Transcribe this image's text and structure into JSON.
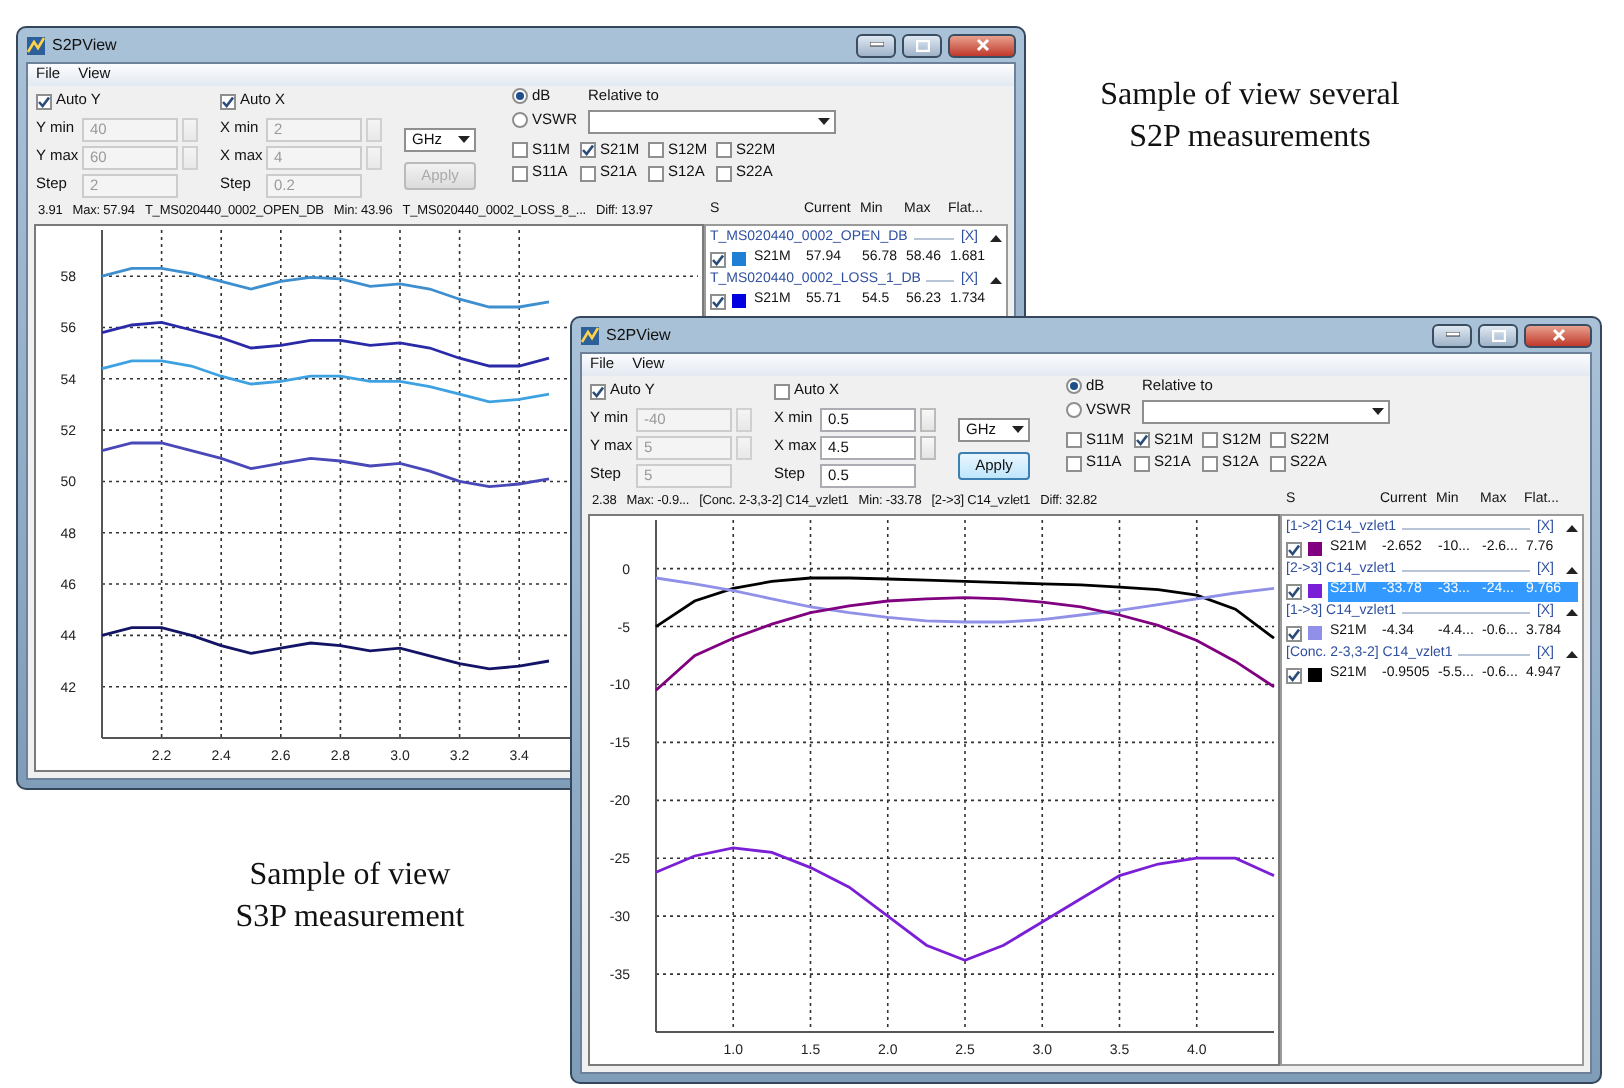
{
  "windows": [
    {
      "title": "S2PView",
      "menu": [
        {
          "label": "File"
        },
        {
          "label": "View"
        }
      ],
      "auto_y": {
        "label": "Auto Y",
        "checked": true
      },
      "y_fields": [
        {
          "label": "Y min",
          "value": "40",
          "kind": "spin",
          "disabled": true
        },
        {
          "label": "Y max",
          "value": "60",
          "kind": "spin",
          "disabled": true
        },
        {
          "label": "Step",
          "value": "2",
          "kind": "text",
          "disabled": true
        }
      ],
      "auto_x": {
        "label": "Auto X",
        "checked": true
      },
      "x_fields": [
        {
          "label": "X min",
          "value": "2",
          "kind": "spin",
          "disabled": true
        },
        {
          "label": "X max",
          "value": "4",
          "kind": "spin",
          "disabled": true
        },
        {
          "label": "Step",
          "value": "0.2",
          "kind": "text",
          "disabled": true
        }
      ],
      "unit": {
        "value": "GHz"
      },
      "apply": {
        "label": "Apply",
        "disabled": true
      },
      "scale": [
        {
          "label": "dB",
          "selected": true
        },
        {
          "label": "VSWR",
          "selected": false
        }
      ],
      "relative_to": {
        "label": "Relative to"
      },
      "params": [
        {
          "label": "S11M",
          "checked": false
        },
        {
          "label": "S21M",
          "checked": true
        },
        {
          "label": "S12M",
          "checked": false
        },
        {
          "label": "S22M",
          "checked": false
        },
        {
          "label": "S11A",
          "checked": false
        },
        {
          "label": "S21A",
          "checked": false
        },
        {
          "label": "S12A",
          "checked": false
        },
        {
          "label": "S22A",
          "checked": false
        }
      ],
      "status": [
        "3.91",
        "Max: 57.94",
        "T_MS020440_0002_OPEN_DB",
        "Min: 43.96",
        "T_MS020440_0002_LOSS_8_...",
        "Diff: 13.97"
      ],
      "list": {
        "columns": [
          "S",
          "Current",
          "Min",
          "Max",
          "Flat..."
        ],
        "groups": [
          {
            "name": "T_MS020440_0002_OPEN_DB",
            "remove": "[X]",
            "rows": [
              {
                "checked": true,
                "color": "#1e7fd4",
                "param": "S21M",
                "current": "57.94",
                "min": "56.78",
                "max": "58.46",
                "flat": "1.681",
                "selected": false
              }
            ]
          },
          {
            "name": "T_MS020440_0002_LOSS_1_DB",
            "remove": "[X]",
            "rows": [
              {
                "checked": true,
                "color": "#0000e0",
                "param": "S21M",
                "current": "55.71",
                "min": "54.5",
                "max": "56.23",
                "flat": "1.734",
                "selected": false
              }
            ]
          }
        ]
      },
      "chart_data": {
        "type": "line",
        "grid": true,
        "x": [
          2.0,
          2.1,
          2.2,
          2.3,
          2.4,
          2.5,
          2.6,
          2.7,
          2.8,
          2.9,
          3.0,
          3.1,
          3.2,
          3.3,
          3.4,
          3.5
        ],
        "xlim": [
          2,
          4
        ],
        "ylim": [
          40,
          59.8
        ],
        "xticks": [
          {
            "value": 2.2,
            "label": "2.2"
          },
          {
            "value": 2.4,
            "label": "2.4"
          },
          {
            "value": 2.6,
            "label": "2.6"
          },
          {
            "value": 2.8,
            "label": "2.8"
          },
          {
            "value": 3.0,
            "label": "3.0"
          },
          {
            "value": 3.2,
            "label": "3.2"
          },
          {
            "value": 3.4,
            "label": "3.4"
          }
        ],
        "yticks": [
          42,
          44,
          46,
          48,
          50,
          52,
          54,
          56,
          58
        ],
        "series": [
          {
            "color": "#3d8fcf",
            "values": [
              58.0,
              58.3,
              58.3,
              58.1,
              57.8,
              57.5,
              57.8,
              57.95,
              57.9,
              57.6,
              57.7,
              57.5,
              57.1,
              56.8,
              56.8,
              57.0
            ]
          },
          {
            "color": "#2a2aa8",
            "values": [
              55.8,
              56.1,
              56.2,
              55.9,
              55.6,
              55.2,
              55.3,
              55.5,
              55.5,
              55.3,
              55.4,
              55.2,
              54.8,
              54.5,
              54.5,
              54.8
            ]
          },
          {
            "color": "#3ea2e2",
            "values": [
              54.4,
              54.7,
              54.7,
              54.5,
              54.1,
              53.8,
              53.9,
              54.1,
              54.1,
              53.9,
              53.9,
              53.7,
              53.4,
              53.1,
              53.2,
              53.4
            ]
          },
          {
            "color": "#4848b8",
            "values": [
              51.2,
              51.5,
              51.5,
              51.2,
              50.9,
              50.5,
              50.7,
              50.9,
              50.8,
              50.6,
              50.7,
              50.4,
              50.0,
              49.8,
              49.9,
              50.1
            ]
          },
          {
            "color": "#141466",
            "values": [
              44.0,
              44.3,
              44.3,
              44.0,
              43.6,
              43.3,
              43.5,
              43.7,
              43.6,
              43.4,
              43.5,
              43.2,
              42.9,
              42.7,
              42.8,
              43.0
            ]
          }
        ]
      }
    },
    {
      "title": "S2PView",
      "menu": [
        {
          "label": "File"
        },
        {
          "label": "View"
        }
      ],
      "auto_y": {
        "label": "Auto Y",
        "checked": true
      },
      "y_fields": [
        {
          "label": "Y min",
          "value": "-40",
          "kind": "spin",
          "disabled": true
        },
        {
          "label": "Y max",
          "value": "5",
          "kind": "spin",
          "disabled": true
        },
        {
          "label": "Step",
          "value": "5",
          "kind": "text",
          "disabled": true
        }
      ],
      "auto_x": {
        "label": "Auto X",
        "checked": false
      },
      "x_fields": [
        {
          "label": "X min",
          "value": "0.5",
          "kind": "spin",
          "disabled": false
        },
        {
          "label": "X max",
          "value": "4.5",
          "kind": "spin",
          "disabled": false
        },
        {
          "label": "Step",
          "value": "0.5",
          "kind": "text",
          "disabled": false
        }
      ],
      "unit": {
        "value": "GHz"
      },
      "apply": {
        "label": "Apply",
        "disabled": false
      },
      "scale": [
        {
          "label": "dB",
          "selected": true
        },
        {
          "label": "VSWR",
          "selected": false
        }
      ],
      "relative_to": {
        "label": "Relative to"
      },
      "params": [
        {
          "label": "S11M",
          "checked": false
        },
        {
          "label": "S21M",
          "checked": true
        },
        {
          "label": "S12M",
          "checked": false
        },
        {
          "label": "S22M",
          "checked": false
        },
        {
          "label": "S11A",
          "checked": false
        },
        {
          "label": "S21A",
          "checked": false
        },
        {
          "label": "S12A",
          "checked": false
        },
        {
          "label": "S22A",
          "checked": false
        }
      ],
      "status": [
        "2.38",
        "Max: -0.9...",
        "[Conc. 2-3,3-2] C14_vzlet1",
        "Min: -33.78",
        "[2->3] C14_vzlet1",
        "Diff: 32.82"
      ],
      "list": {
        "columns": [
          "S",
          "Current",
          "Min",
          "Max",
          "Flat..."
        ],
        "groups": [
          {
            "name": "[1->2] C14_vzlet1",
            "remove": "[X]",
            "rows": [
              {
                "checked": true,
                "color": "#800080",
                "param": "S21M",
                "current": "-2.652",
                "min": "-10...",
                "max": "-2.6...",
                "flat": "7.76",
                "selected": false
              }
            ]
          },
          {
            "name": "[2->3] C14_vzlet1",
            "remove": "[X]",
            "rows": [
              {
                "checked": true,
                "color": "#7a1fd6",
                "param": "S21M",
                "current": "-33.78",
                "min": "-33...",
                "max": "-24...",
                "flat": "9.766",
                "selected": true
              }
            ]
          },
          {
            "name": "[1->3] C14_vzlet1",
            "remove": "[X]",
            "rows": [
              {
                "checked": true,
                "color": "#9090e8",
                "param": "S21M",
                "current": "-4.34",
                "min": "-4.4...",
                "max": "-0.6...",
                "flat": "3.784",
                "selected": false
              }
            ]
          },
          {
            "name": "[Conc. 2-3,3-2] C14_vzlet1",
            "remove": "[X]",
            "rows": [
              {
                "checked": true,
                "color": "#000000",
                "param": "S21M",
                "current": "-0.9505",
                "min": "-5.5...",
                "max": "-0.6...",
                "flat": "4.947",
                "selected": false
              }
            ]
          }
        ]
      },
      "chart_data": {
        "type": "line",
        "grid": true,
        "x": [
          0.5,
          0.75,
          1.0,
          1.25,
          1.5,
          1.75,
          2.0,
          2.25,
          2.5,
          2.75,
          3.0,
          3.25,
          3.5,
          3.75,
          4.0,
          4.25,
          4.5
        ],
        "xlim": [
          0.5,
          4.5
        ],
        "ylim": [
          -40,
          4.2
        ],
        "xticks": [
          {
            "value": 1.0,
            "label": "1.0"
          },
          {
            "value": 1.5,
            "label": "1.5"
          },
          {
            "value": 2.0,
            "label": "2.0"
          },
          {
            "value": 2.5,
            "label": "2.5"
          },
          {
            "value": 3.0,
            "label": "3.0"
          },
          {
            "value": 3.5,
            "label": "3.5"
          },
          {
            "value": 4.0,
            "label": "4.0"
          }
        ],
        "yticks": [
          -35,
          -30,
          -25,
          -20,
          -15,
          -10,
          -5,
          0
        ],
        "series": [
          {
            "color": "#000000",
            "values": [
              -5,
              -2.8,
              -1.7,
              -1.1,
              -0.8,
              -0.8,
              -0.9,
              -1.0,
              -1.1,
              -1.2,
              -1.3,
              -1.4,
              -1.6,
              -1.8,
              -2.3,
              -3.5,
              -6
            ]
          },
          {
            "color": "#9090e8",
            "values": [
              -0.8,
              -1.3,
              -1.9,
              -2.6,
              -3.3,
              -3.8,
              -4.2,
              -4.5,
              -4.6,
              -4.6,
              -4.4,
              -4.0,
              -3.6,
              -3.1,
              -2.6,
              -2.1,
              -1.7
            ]
          },
          {
            "color": "#800080",
            "values": [
              -10.5,
              -7.5,
              -6,
              -4.8,
              -3.8,
              -3.2,
              -2.8,
              -2.6,
              -2.5,
              -2.6,
              -2.9,
              -3.3,
              -4,
              -4.9,
              -6.2,
              -8,
              -10.2
            ]
          },
          {
            "color": "#7a1fd6",
            "values": [
              -26.2,
              -24.8,
              -24.1,
              -24.5,
              -25.8,
              -27.5,
              -30,
              -32.5,
              -33.8,
              -32.5,
              -30.5,
              -28.5,
              -26.5,
              -25.5,
              -25,
              -25,
              -26.5
            ]
          }
        ]
      }
    }
  ],
  "captions": [
    {
      "lines": [
        "Sample of view several",
        "S2P measurements"
      ]
    },
    {
      "lines": [
        "Sample of view",
        "S3P measurement"
      ]
    }
  ]
}
